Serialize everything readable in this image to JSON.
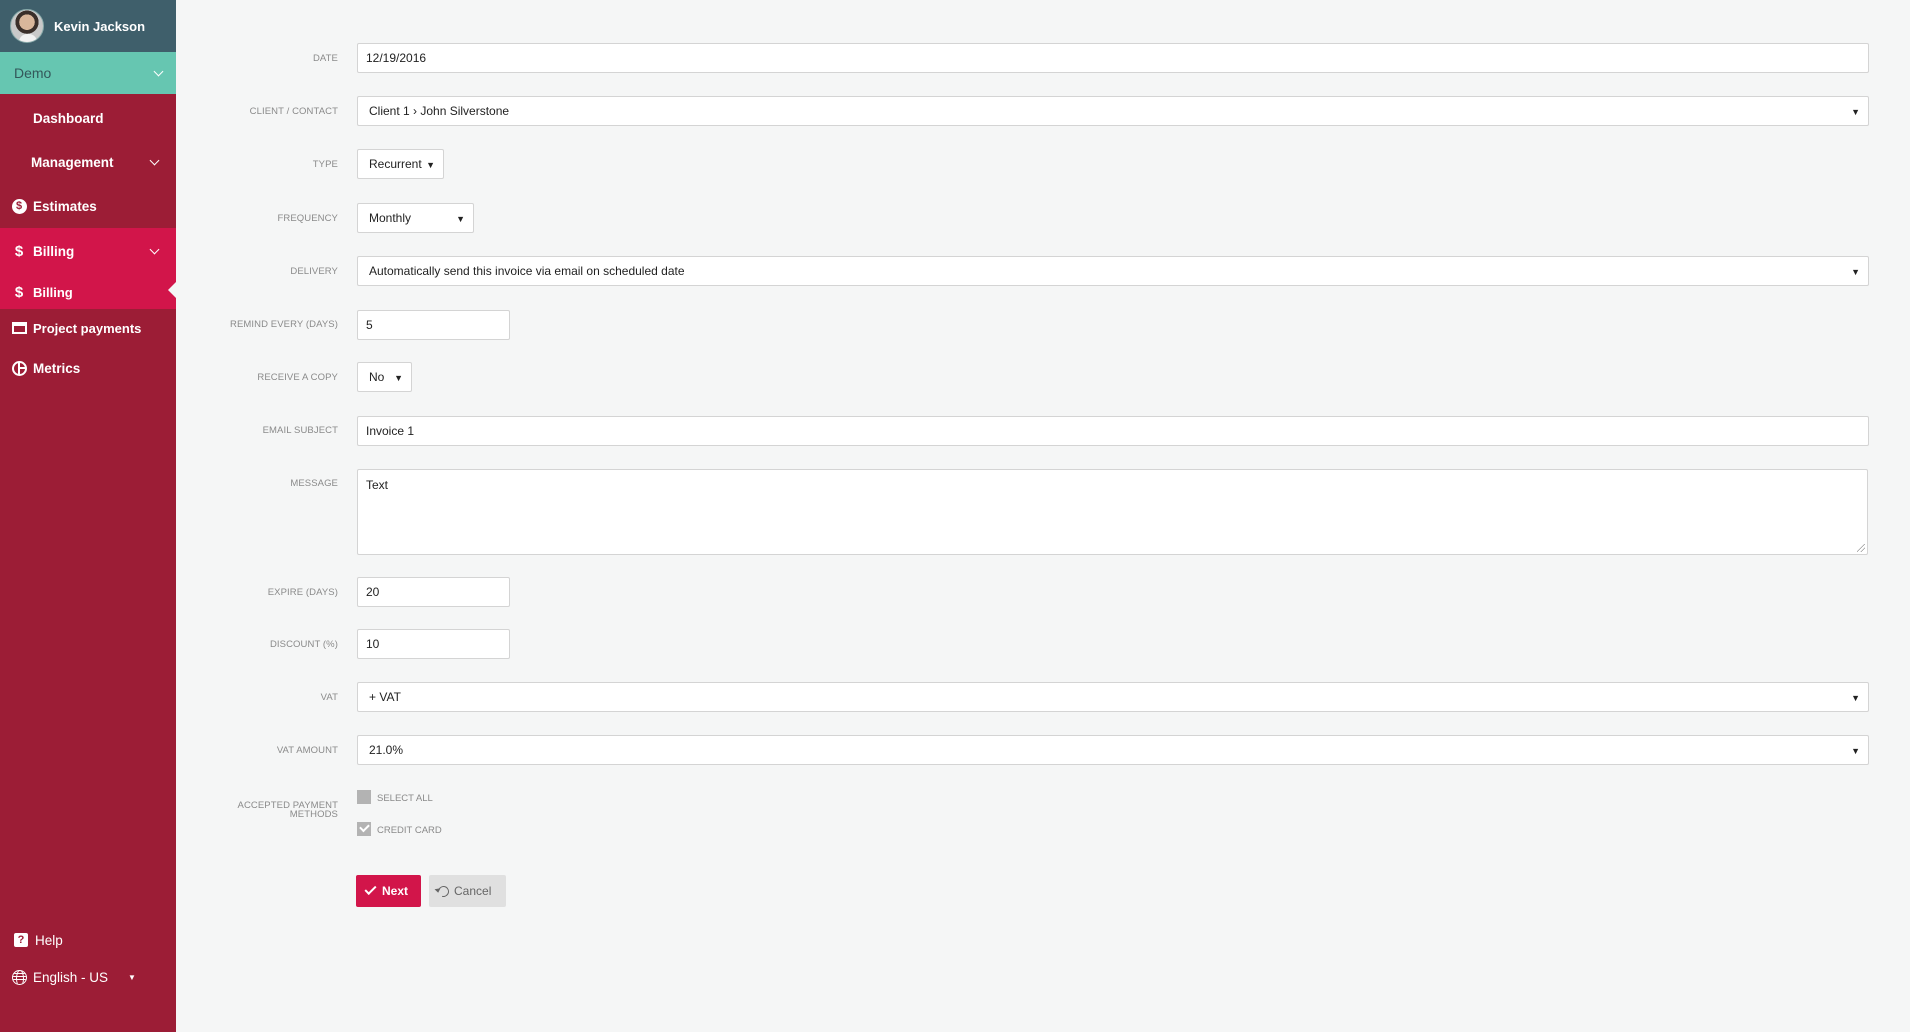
{
  "sidebar": {
    "user_name": "Kevin Jackson",
    "workspace": "Demo",
    "items": [
      {
        "label": "Dashboard",
        "icon": "dashboard-icon"
      },
      {
        "label": "Management",
        "icon": "none"
      },
      {
        "label": "Estimates",
        "icon": "dollar-coin-icon"
      },
      {
        "label": "Billing",
        "icon": "dollar-icon"
      },
      {
        "label": "Billing",
        "icon": "dollar-icon"
      },
      {
        "label": "Project payments",
        "icon": "credit-card-icon"
      },
      {
        "label": "Metrics",
        "icon": "pie-chart-icon"
      }
    ],
    "help_label": "Help",
    "language": "English - US",
    "coin_glyph": "$",
    "dollar_glyph": "$",
    "help_glyph": "?"
  },
  "form": {
    "date": {
      "label": "DATE",
      "value": "12/19/2016"
    },
    "client": {
      "label": "CLIENT / CONTACT",
      "value": "Client 1 › John Silverstone"
    },
    "type": {
      "label": "TYPE",
      "value": "Recurrent"
    },
    "frequency": {
      "label": "FREQUENCY",
      "value": "Monthly"
    },
    "delivery": {
      "label": "DELIVERY",
      "value": "Automatically send this invoice via email on scheduled date"
    },
    "remind": {
      "label": "REMIND EVERY (DAYS)",
      "value": "5"
    },
    "receive_copy": {
      "label": "RECEIVE A COPY",
      "value": "No"
    },
    "email_subject": {
      "label": "EMAIL SUBJECT",
      "value": "Invoice 1"
    },
    "message": {
      "label": "MESSAGE",
      "value": "Text"
    },
    "expire": {
      "label": "EXPIRE (DAYS)",
      "value": "20"
    },
    "discount": {
      "label": "DISCOUNT (%)",
      "value": "10"
    },
    "vat": {
      "label": "VAT",
      "value": "+ VAT"
    },
    "vat_amount": {
      "label": "VAT AMOUNT",
      "value": "21.0%"
    },
    "payment_methods": {
      "label_line1": "ACCEPTED PAYMENT",
      "label_line2": "METHODS",
      "options": [
        {
          "label": "SELECT ALL",
          "checked": false
        },
        {
          "label": "CREDIT CARD",
          "checked": true
        }
      ]
    },
    "caret": "▼"
  },
  "actions": {
    "next_label": "Next",
    "cancel_label": "Cancel"
  },
  "colors": {
    "sidebar": "#9c1d36",
    "active": "#d2154a",
    "header": "#3f5f6b",
    "workspace_bar": "#66c6b1"
  }
}
